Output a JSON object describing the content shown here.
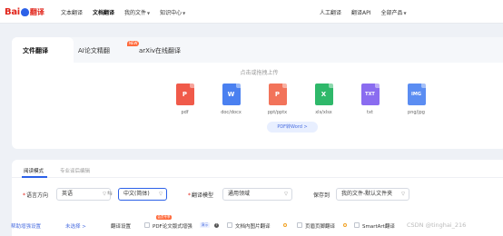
{
  "header": {
    "logo_text": "Bai",
    "logo_suffix": "翻译",
    "nav_left": [
      "文本翻译",
      "文档翻译",
      "我的文件",
      "知识中心"
    ],
    "nav_right": [
      "人工翻译",
      "翻译API",
      "全部产品"
    ]
  },
  "upload": {
    "tabs": [
      "文件翻译",
      "AI论文精翻",
      "arXiv在线翻译"
    ],
    "new_badge": "NEW",
    "hint": "点击或拖拽上传",
    "formats": [
      {
        "label": "pdf",
        "glyph": "P",
        "color": "#f05a4a"
      },
      {
        "label": "doc/docx",
        "glyph": "W",
        "color": "#4a80f0"
      },
      {
        "label": "ppt/pptx",
        "glyph": "P",
        "color": "#f2735a"
      },
      {
        "label": "xls/xlsx",
        "glyph": "X",
        "color": "#2fb86a"
      },
      {
        "label": "txt",
        "glyph": "TXT",
        "color": "#8a6cf0"
      },
      {
        "label": "png/jpg",
        "glyph": "IMG",
        "color": "#5b8df2"
      }
    ],
    "pdf_to_word": "PDF转Word >"
  },
  "options": {
    "tabs": [
      "阅读模式",
      "专业译后编辑"
    ],
    "lang_label": "语言方向",
    "source_lang": "英语",
    "target_lang": "中文(简体)",
    "model_label": "翻译模型",
    "model_value": "通用领域",
    "save_label": "保存到",
    "save_value": "我的文件-默认文件夹",
    "help_link": "帮助增强设置",
    "unselected": "未选择 >",
    "settings_label": "翻译设置",
    "vip_badge": "会员专享",
    "pdf_enhance": "PDF论文版式增强",
    "demo_badge": "演示",
    "doc_image": "文档内图片翻译",
    "header_footer": "页眉页脚翻译",
    "smartart": "SmartArt翻译"
  },
  "watermark": "CSDN @tinghai_216"
}
